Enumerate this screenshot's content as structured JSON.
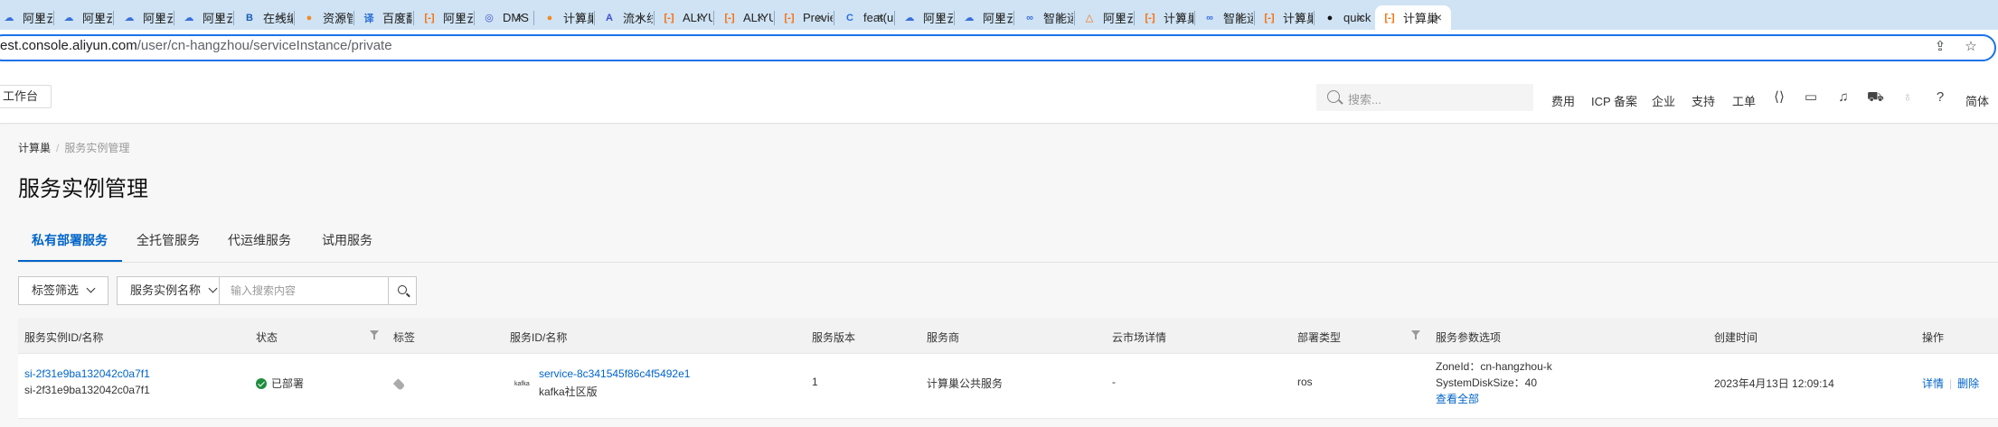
{
  "browser": {
    "tabs": [
      {
        "label": "阿里云",
        "icon": "tab-favicon",
        "color": "#3b6fd9",
        "glyph": "☁"
      },
      {
        "label": "阿里云",
        "icon": "cloud-icon",
        "color": "#3b6fd9",
        "glyph": "☁"
      },
      {
        "label": "阿里云",
        "icon": "cloud-icon",
        "color": "#3b6fd9",
        "glyph": "☁"
      },
      {
        "label": "阿里云",
        "icon": "cloud-icon",
        "color": "#3b6fd9",
        "glyph": "☁"
      },
      {
        "label": "在线编",
        "icon": "bracket-icon",
        "color": "#1a5fb4",
        "glyph": "B"
      },
      {
        "label": "资源管",
        "icon": "leaf-icon",
        "color": "#f08a24",
        "glyph": "●"
      },
      {
        "label": "百度翻",
        "icon": "translate-icon",
        "color": "#2b6cd6",
        "glyph": "译"
      },
      {
        "label": "阿里云",
        "icon": "aliyun-icon",
        "color": "#ff6a00",
        "glyph": "[-]"
      },
      {
        "label": "DMS",
        "icon": "dms-icon",
        "color": "#3f4fd0",
        "glyph": "◎"
      },
      {
        "label": "计算巢",
        "icon": "leaf-icon",
        "color": "#f08a24",
        "glyph": "●"
      },
      {
        "label": "流水线",
        "icon": "pipeline-icon",
        "color": "#3f4fd0",
        "glyph": "A"
      },
      {
        "label": "ALIYUN",
        "icon": "aliyun-icon",
        "color": "#ff6a00",
        "glyph": "[-]"
      },
      {
        "label": "ALIYUN",
        "icon": "aliyun-icon",
        "color": "#ff6a00",
        "glyph": "[-]"
      },
      {
        "label": "Preview",
        "icon": "aliyun-icon",
        "color": "#ff6a00",
        "glyph": "[-]"
      },
      {
        "label": "feat(ui",
        "icon": "c-icon",
        "color": "#2f6fe0",
        "glyph": "C"
      },
      {
        "label": "阿里云",
        "icon": "cloud-icon",
        "color": "#3b6fd9",
        "glyph": "☁"
      },
      {
        "label": "阿里云",
        "icon": "cloud-icon",
        "color": "#3b6fd9",
        "glyph": "☁"
      },
      {
        "label": "智能运",
        "icon": "link-icon",
        "color": "#3b6fd9",
        "glyph": "∞"
      },
      {
        "label": "阿里云",
        "icon": "triangle-icon",
        "color": "#ff6a00",
        "glyph": "△"
      },
      {
        "label": "计算巢",
        "icon": "aliyun-icon",
        "color": "#ff6a00",
        "glyph": "[-]"
      },
      {
        "label": "智能运",
        "icon": "link-icon",
        "color": "#3b6fd9",
        "glyph": "∞"
      },
      {
        "label": "计算巢",
        "icon": "aliyun-icon",
        "color": "#ff6a00",
        "glyph": "[-]"
      },
      {
        "label": "quick",
        "icon": "github-icon",
        "color": "#111111",
        "glyph": "●"
      },
      {
        "label": "计算巢",
        "icon": "aliyun-icon",
        "color": "#ff6a00",
        "glyph": "[-]",
        "active": true
      }
    ],
    "url_host": "est.console.aliyun.com",
    "url_path": "/user/cn-hangzhou/serviceInstance/private"
  },
  "topnav": {
    "workbench": "工作台",
    "search_placeholder": "搜索...",
    "links": [
      "费用",
      "ICP 备案",
      "企业",
      "支持",
      "工单"
    ],
    "language": "简体"
  },
  "breadcrumb": {
    "root": "计算巢",
    "current": "服务实例管理"
  },
  "page_title": "服务实例管理",
  "tabs": [
    "私有部署服务",
    "全托管服务",
    "代运维服务",
    "试用服务"
  ],
  "filters": {
    "tag_filter": "标签筛选",
    "field_select": "服务实例名称",
    "search_placeholder": "输入搜索内容"
  },
  "table": {
    "columns": [
      "服务实例ID/名称",
      "状态",
      "标签",
      "服务ID/名称",
      "服务版本",
      "服务商",
      "云市场详情",
      "部署类型",
      "服务参数选项",
      "创建时间",
      "操作"
    ],
    "rows": [
      {
        "instance_id": "si-2f31e9ba132042c0a7f1",
        "instance_name": "si-2f31e9ba132042c0a7f1",
        "status": "已部署",
        "service_id": "service-8c341545f86c4f5492e1",
        "service_name": "kafka社区版",
        "service_logo": "kafka",
        "version": "1",
        "provider": "计算巢公共服务",
        "market": "-",
        "deploy_type": "ros",
        "param_zone": "ZoneId：cn-hangzhou-k",
        "param_disk": "SystemDiskSize：40",
        "param_more": "查看全部",
        "created": "2023年4月13日 12:09:14",
        "action_detail": "详情",
        "action_delete": "删除"
      }
    ]
  },
  "colors": {
    "accent": "#0064c8",
    "success": "#1e8e3e",
    "brand": "#ff6a00"
  }
}
